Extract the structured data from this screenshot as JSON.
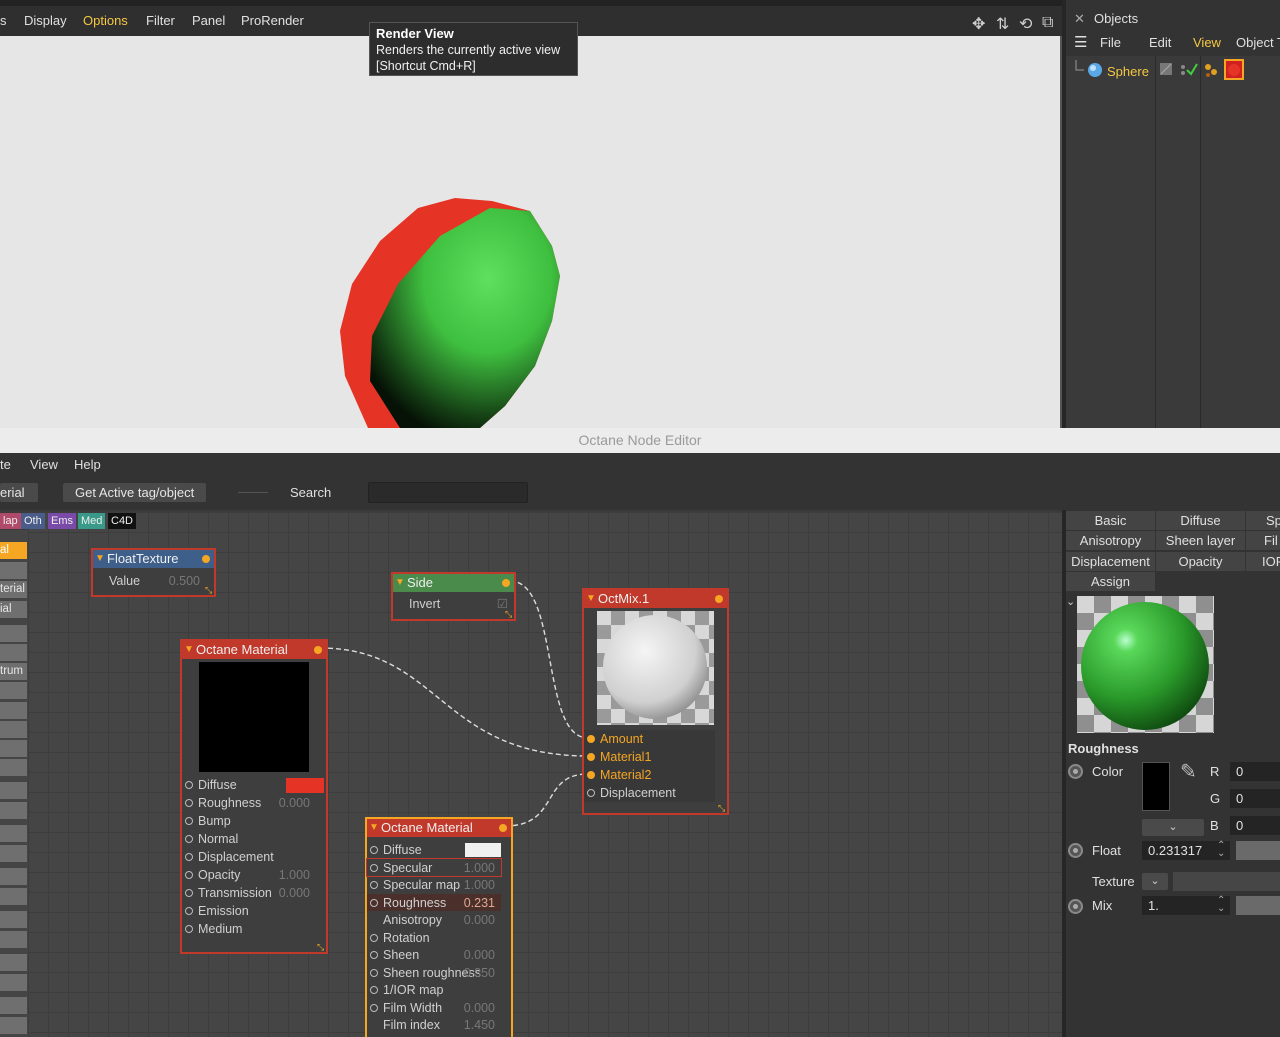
{
  "viewport": {
    "menu": [
      "s",
      "Display",
      "Options",
      "Filter",
      "Panel",
      "ProRender"
    ],
    "tooltip": {
      "title": "Render View",
      "line1": "Renders the currently active view",
      "line2": "[Shortcut Cmd+R]"
    }
  },
  "objects": {
    "title": "Objects",
    "menu": [
      "File",
      "Edit",
      "View",
      "Object",
      "T"
    ],
    "items": [
      {
        "name": "Sphere"
      }
    ]
  },
  "node_editor": {
    "title": "Octane Node Editor",
    "menu": [
      "te",
      "View",
      "Help"
    ],
    "toolbar": {
      "material_btn": "erial",
      "get_active_btn": "Get Active tag/object",
      "search_label": "Search"
    },
    "categories": [
      "lap",
      "Oth",
      "Ems",
      "Med",
      "C4D"
    ],
    "left_list": [
      "al",
      "",
      "terial",
      "ial",
      "",
      "",
      "trum",
      "",
      "",
      "",
      "",
      "",
      "",
      "",
      "",
      "",
      "",
      "",
      "",
      "",
      "",
      "",
      "",
      "",
      "",
      ""
    ],
    "nodes": {
      "float_texture": {
        "title": "FloatTexture",
        "rows": [
          {
            "label": "Value",
            "value": "0.500"
          }
        ]
      },
      "side": {
        "title": "Side",
        "rows": [
          {
            "label": "Invert",
            "value": "☑"
          }
        ]
      },
      "octane_material_1": {
        "title": "Octane Material",
        "rows": [
          {
            "label": "Diffuse",
            "value": ""
          },
          {
            "label": "Roughness",
            "value": "0.000"
          },
          {
            "label": "Bump",
            "value": ""
          },
          {
            "label": "Normal",
            "value": ""
          },
          {
            "label": "Displacement",
            "value": ""
          },
          {
            "label": "Opacity",
            "value": "1.000"
          },
          {
            "label": "Transmission",
            "value": "0.000"
          },
          {
            "label": "Emission",
            "value": ""
          },
          {
            "label": "Medium",
            "value": ""
          }
        ]
      },
      "octane_material_2": {
        "title": "Octane Material",
        "rows": [
          {
            "label": "Diffuse",
            "value": ""
          },
          {
            "label": "Specular",
            "value": "1.000"
          },
          {
            "label": "Specular map",
            "value": "1.000"
          },
          {
            "label": "Roughness",
            "value": "0.231"
          },
          {
            "label": "Anisotropy",
            "value": "0.000"
          },
          {
            "label": "Rotation",
            "value": ""
          },
          {
            "label": "Sheen",
            "value": "0.000"
          },
          {
            "label": "Sheen roughness",
            "value": "0.350"
          },
          {
            "label": "1/IOR map",
            "value": ""
          },
          {
            "label": "Film Width",
            "value": "0.000"
          },
          {
            "label": "Film index",
            "value": "1.450"
          }
        ]
      },
      "octmix": {
        "title": "OctMix.1",
        "rows": [
          {
            "label": "Amount"
          },
          {
            "label": "Material1"
          },
          {
            "label": "Material2"
          },
          {
            "label": "Displacement"
          }
        ]
      }
    }
  },
  "attributes": {
    "tabs": [
      "Basic",
      "Diffuse",
      "Sp",
      "Anisotropy",
      "Sheen layer",
      "Fil",
      "Displacement",
      "Opacity",
      "IOR",
      "Assign"
    ],
    "section": "Roughness",
    "color_label": "Color",
    "r_label": "R",
    "r_value": "0",
    "g_label": "G",
    "g_value": "0",
    "b_label": "B",
    "b_value": "0",
    "float_label": "Float",
    "float_value": "0.231317",
    "texture_label": "Texture",
    "mix_label": "Mix",
    "mix_value": "1."
  },
  "colors": {
    "accent": "#f5a623",
    "node_border": "#c0392b",
    "diffuse_red": "#e53425",
    "sphere_green": "#3bbf3b"
  }
}
